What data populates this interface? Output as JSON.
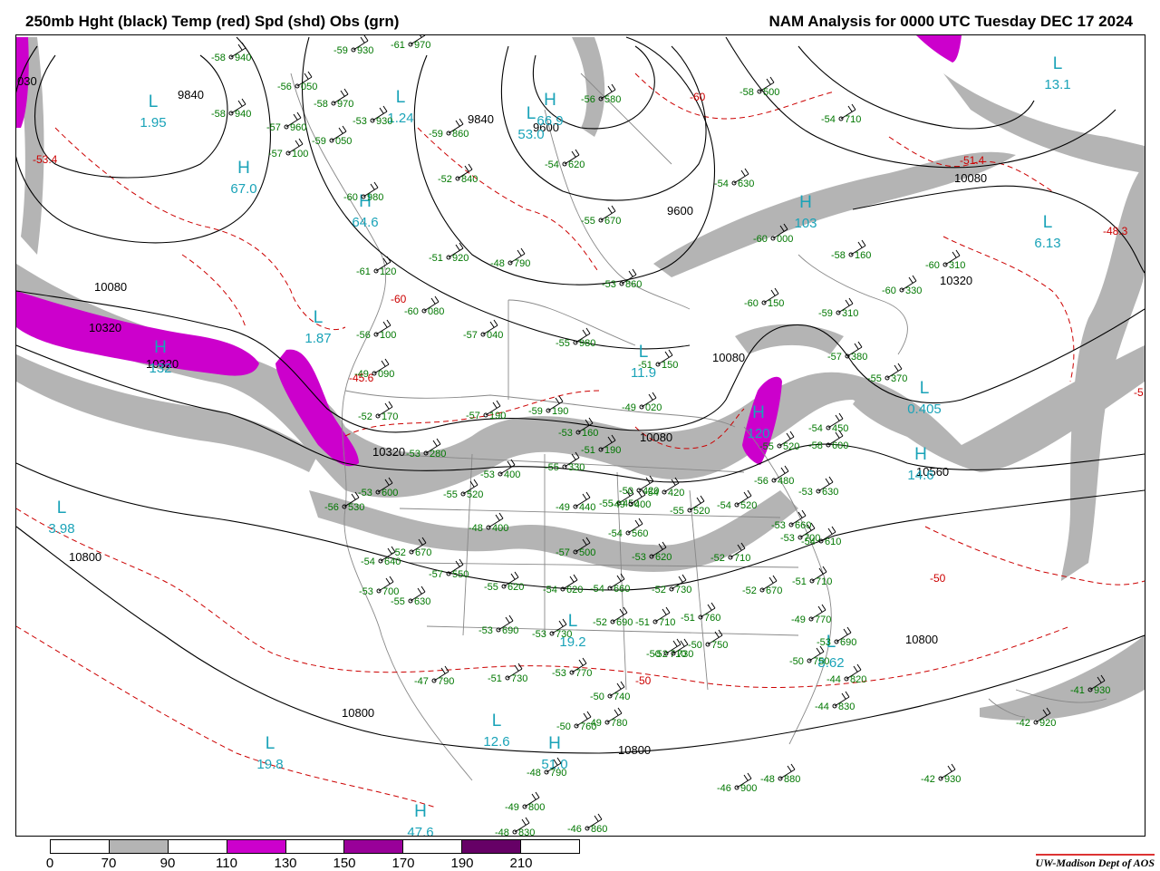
{
  "header": {
    "title_left": "250mb Hght (black) Temp (red) Spd (shd) Obs (grn)",
    "title_right": "NAM Analysis for 0000 UTC Tuesday  DEC 17 2024"
  },
  "colors": {
    "height_contour": "#000000",
    "temp_contour": "#cc0000",
    "obs": "#007700",
    "center_label": "#1aa3b8",
    "high_label_warm": "#cc0000",
    "speed_70_90": "#b4b4b4",
    "speed_110_130": "#cc00cc",
    "speed_150_170": "#990099",
    "speed_190_210": "#660066"
  },
  "colorbar": {
    "ticks": [
      "0",
      "70",
      "90",
      "110",
      "130",
      "150",
      "170",
      "190",
      "210"
    ],
    "segments": [
      "#ffffff",
      "#b4b4b4",
      "#ffffff",
      "#cc00cc",
      "#ffffff",
      "#990099",
      "#ffffff",
      "#660066",
      "#ffffff"
    ]
  },
  "credit": "UW-Madison  Dept of AOS",
  "height_labels": [
    "9840",
    "9840",
    "9600",
    "9600",
    "10080",
    "10080",
    "10320",
    "10320",
    "10320",
    "10080",
    "10320",
    "10560",
    "10080",
    "10800",
    "10800",
    "10800",
    "10800",
    "030"
  ],
  "temp_labels": [
    "-60",
    "-60",
    "-50",
    "-50",
    "-51.4",
    "-48.3",
    "-53.4",
    "-45.6",
    "-5"
  ],
  "centers": [
    {
      "type": "L",
      "value": "1.95"
    },
    {
      "type": "H",
      "value": "67.0"
    },
    {
      "type": "L",
      "value": "1.24"
    },
    {
      "type": "H",
      "value": "66.9"
    },
    {
      "type": "H",
      "value": "64.6"
    },
    {
      "type": "L",
      "value": "1.87"
    },
    {
      "type": "H",
      "value": "132"
    },
    {
      "type": "L",
      "value": "3.98"
    },
    {
      "type": "L",
      "value": "19.8"
    },
    {
      "type": "H",
      "value": "47.6"
    },
    {
      "type": "L",
      "value": "12.6"
    },
    {
      "type": "H",
      "value": "51.0"
    },
    {
      "type": "L",
      "value": "19.2"
    },
    {
      "type": "L",
      "value": "11.9"
    },
    {
      "type": "H",
      "value": "103"
    },
    {
      "type": "L",
      "value": "6.13"
    },
    {
      "type": "L",
      "value": "13.1"
    },
    {
      "type": "L",
      "value": "0.405"
    },
    {
      "type": "H",
      "value": "14.6"
    },
    {
      "type": "H",
      "value": "120"
    },
    {
      "type": "L",
      "value": "8.62"
    },
    {
      "type": "L",
      "value": "53.0"
    }
  ],
  "obs": [
    {
      "t": "-58",
      "h": "940"
    },
    {
      "t": "-59",
      "h": "930"
    },
    {
      "t": "-61",
      "h": "970"
    },
    {
      "t": "-58",
      "h": "940"
    },
    {
      "t": "-56",
      "h": "050"
    },
    {
      "t": "-58",
      "h": "970"
    },
    {
      "t": "-53",
      "h": "930"
    },
    {
      "t": "-57",
      "h": "960"
    },
    {
      "t": "-59",
      "h": "050"
    },
    {
      "t": "-57",
      "h": "100"
    },
    {
      "t": "-59",
      "h": "860"
    },
    {
      "t": "-52",
      "h": "840"
    },
    {
      "t": "-60",
      "h": "980"
    },
    {
      "t": "-55",
      "h": "670"
    },
    {
      "t": "-54",
      "h": "620"
    },
    {
      "t": "-56",
      "h": "580"
    },
    {
      "t": "-58",
      "h": "500"
    },
    {
      "t": "-54",
      "h": "710"
    },
    {
      "t": "-54",
      "h": "630"
    },
    {
      "t": "-60",
      "h": "000"
    },
    {
      "t": "-58",
      "h": "160"
    },
    {
      "t": "-60",
      "h": "310"
    },
    {
      "t": "-60",
      "h": "330"
    },
    {
      "t": "-51",
      "h": "920"
    },
    {
      "t": "-48",
      "h": "790"
    },
    {
      "t": "-53",
      "h": "860"
    },
    {
      "t": "-61",
      "h": "120"
    },
    {
      "t": "-60",
      "h": "080"
    },
    {
      "t": "-57",
      "h": "040"
    },
    {
      "t": "-55",
      "h": "980"
    },
    {
      "t": "-60",
      "h": "150"
    },
    {
      "t": "-59",
      "h": "310"
    },
    {
      "t": "-57",
      "h": "380"
    },
    {
      "t": "-55",
      "h": "370"
    },
    {
      "t": "-56",
      "h": "100"
    },
    {
      "t": "-49",
      "h": "090"
    },
    {
      "t": "-52",
      "h": "170"
    },
    {
      "t": "-49",
      "h": "020"
    },
    {
      "t": "-51",
      "h": "150"
    },
    {
      "t": "-57",
      "h": "190"
    },
    {
      "t": "-59",
      "h": "190"
    },
    {
      "t": "-53",
      "h": "160"
    },
    {
      "t": "-51",
      "h": "190"
    },
    {
      "t": "-53",
      "h": "280"
    },
    {
      "t": "-55",
      "h": "330"
    },
    {
      "t": "-53",
      "h": "400"
    },
    {
      "t": "-49",
      "h": "440"
    },
    {
      "t": "-55",
      "h": "450"
    },
    {
      "t": "-55",
      "h": "520"
    },
    {
      "t": "-53",
      "h": "600"
    },
    {
      "t": "-56",
      "h": "530"
    },
    {
      "t": "-48",
      "h": "400"
    },
    {
      "t": "-50",
      "h": "420"
    },
    {
      "t": "-54",
      "h": "420"
    },
    {
      "t": "-55",
      "h": "520"
    },
    {
      "t": "-54",
      "h": "520"
    },
    {
      "t": "-56",
      "h": "480"
    },
    {
      "t": "-54",
      "h": "450"
    },
    {
      "t": "-55",
      "h": "520"
    },
    {
      "t": "-58",
      "h": "600"
    },
    {
      "t": "-53",
      "h": "630"
    },
    {
      "t": "-53",
      "h": "660"
    },
    {
      "t": "-53",
      "h": "700"
    },
    {
      "t": "-54",
      "h": "610"
    },
    {
      "t": "-52",
      "h": "670"
    },
    {
      "t": "-54",
      "h": "640"
    },
    {
      "t": "-57",
      "h": "550"
    },
    {
      "t": "-57",
      "h": "500"
    },
    {
      "t": "-54",
      "h": "560"
    },
    {
      "t": "-53",
      "h": "620"
    },
    {
      "t": "-52",
      "h": "710"
    },
    {
      "t": "-53",
      "h": "700"
    },
    {
      "t": "-55",
      "h": "630"
    },
    {
      "t": "-55",
      "h": "620"
    },
    {
      "t": "-54",
      "h": "620"
    },
    {
      "t": "-54",
      "h": "660"
    },
    {
      "t": "-52",
      "h": "730"
    },
    {
      "t": "-51",
      "h": "710"
    },
    {
      "t": "-52",
      "h": "670"
    },
    {
      "t": "-52",
      "h": "690"
    },
    {
      "t": "-51",
      "h": "710"
    },
    {
      "t": "-51",
      "h": "760"
    },
    {
      "t": "-49",
      "h": "770"
    },
    {
      "t": "-53",
      "h": "690"
    },
    {
      "t": "-53",
      "h": "690"
    },
    {
      "t": "-53",
      "h": "730"
    },
    {
      "t": "-50",
      "h": "710"
    },
    {
      "t": "-53",
      "h": "770"
    },
    {
      "t": "-51",
      "h": "730"
    },
    {
      "t": "-50",
      "h": "740"
    },
    {
      "t": "-49",
      "h": "780"
    },
    {
      "t": "-50",
      "h": "750"
    },
    {
      "t": "-52",
      "h": "730"
    },
    {
      "t": "-50",
      "h": "750"
    },
    {
      "t": "-47",
      "h": "790"
    },
    {
      "t": "-44",
      "h": "820"
    },
    {
      "t": "-44",
      "h": "830"
    },
    {
      "t": "-50",
      "h": "760"
    },
    {
      "t": "-48",
      "h": "790"
    },
    {
      "t": "-49",
      "h": "800"
    },
    {
      "t": "-48",
      "h": "830"
    },
    {
      "t": "-46",
      "h": "860"
    },
    {
      "t": "-46",
      "h": "900"
    },
    {
      "t": "-48",
      "h": "880"
    },
    {
      "t": "-42",
      "h": "930"
    },
    {
      "t": "-42",
      "h": "920"
    },
    {
      "t": "-41",
      "h": "930"
    },
    {
      "t": "-49",
      "h": "400"
    }
  ]
}
